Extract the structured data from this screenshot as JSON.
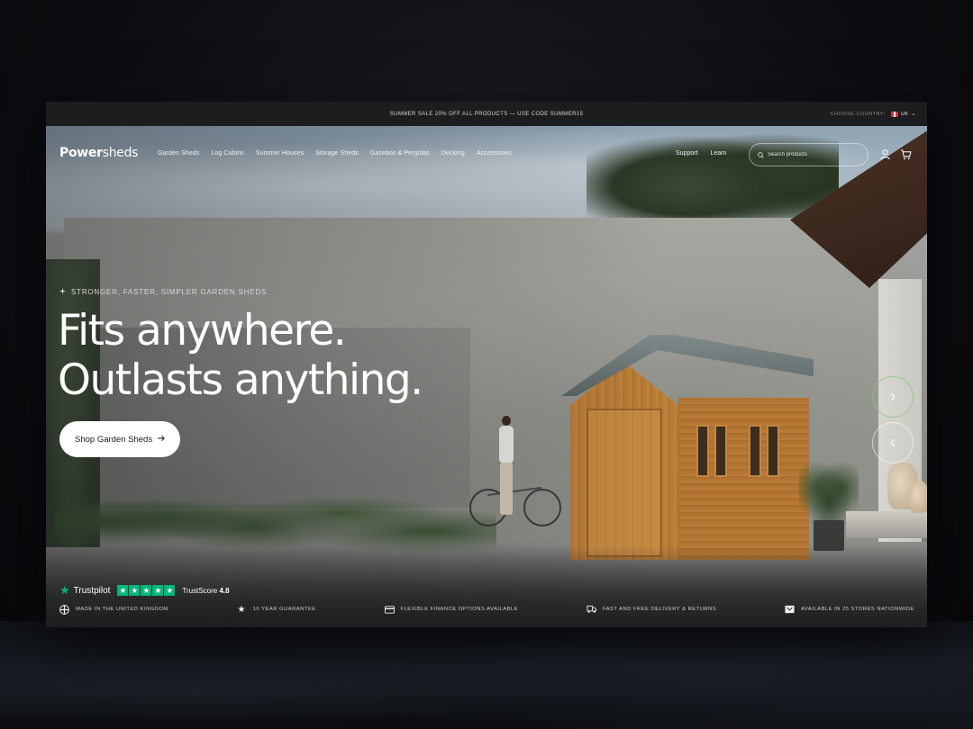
{
  "announcement": {
    "text": "SUMMER SALE  20% OFF ALL PRODUCTS — USE CODE SUMMER15",
    "country_label": "CHOOSE COUNTRY:",
    "country_value": "UK"
  },
  "brand": {
    "logo_bold": "Power",
    "logo_light": "sheds"
  },
  "nav": {
    "links": [
      "Garden Sheds",
      "Log Cabins",
      "Summer Houses",
      "Storage Sheds",
      "Gazebos & Pergolas",
      "Decking",
      "Accessories"
    ],
    "right_links": [
      "Support",
      "Learn"
    ],
    "search_placeholder": "Search products"
  },
  "hero": {
    "eyebrow": "STRONGER, FASTER, SIMPLER GARDEN SHEDS",
    "headline_line1": "Fits anywhere.",
    "headline_line2": "Outlasts anything.",
    "cta_label": "Shop Garden Sheds"
  },
  "trustpilot": {
    "brand": "Trustpilot",
    "score_label": "TrustScore",
    "score": "4.8",
    "stars": 5
  },
  "features": [
    {
      "icon": "uk-flag-icon",
      "text": "MADE IN THE UNITED KINGDOM"
    },
    {
      "icon": "star-icon",
      "text": "10 YEAR GUARANTEE"
    },
    {
      "icon": "card-icon",
      "text": "FLEXIBLE FINANCE OPTIONS AVAILABLE"
    },
    {
      "icon": "truck-icon",
      "text": "FAST AND FREE DELIVERY & RETURNS"
    },
    {
      "icon": "store-icon",
      "text": "AVAILABLE IN 25 STORES NATIONWIDE"
    }
  ],
  "colors": {
    "trustpilot_green": "#00b67a",
    "announcement_bg": "#1c1d1f",
    "cta_bg": "#ffffff"
  }
}
